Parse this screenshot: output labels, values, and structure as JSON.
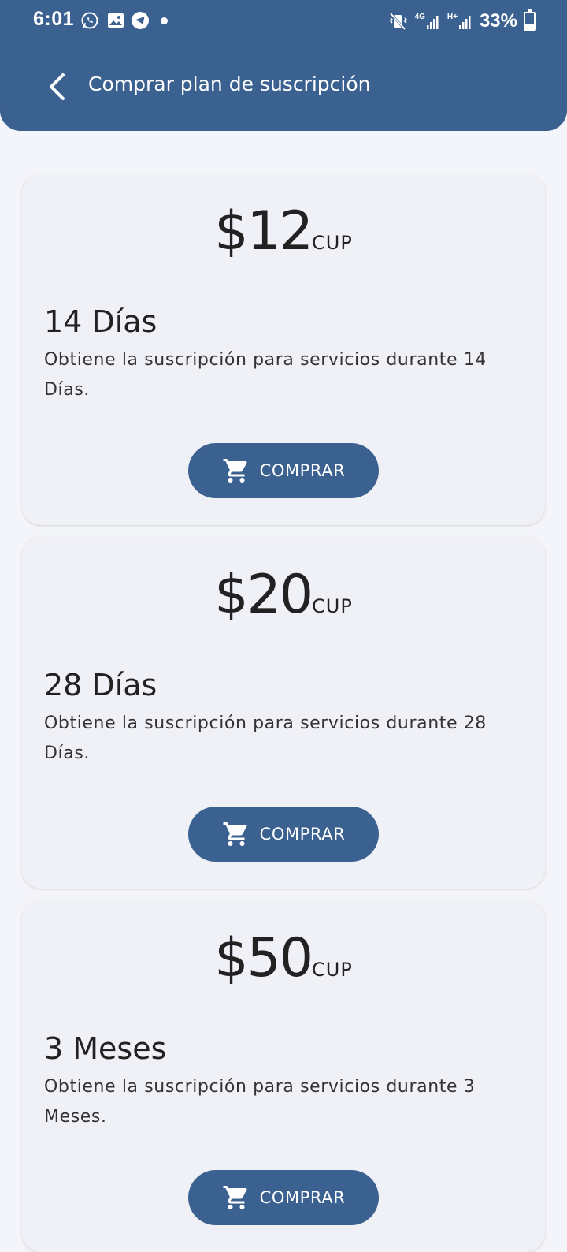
{
  "status_bar": {
    "time": "6:01",
    "network_1": "4G",
    "network_2": "H+",
    "battery": "33%",
    "battery_level": 0.33,
    "icons": [
      "whatsapp-icon",
      "gallery-icon",
      "telegram-icon",
      "notification-dot-icon",
      "mute-vibrate-icon",
      "signal-icon",
      "signal-icon",
      "battery-icon"
    ]
  },
  "header": {
    "title": "Comprar plan de suscripción",
    "back_icon": "chevron-left-icon"
  },
  "plans": [
    {
      "price": "$12",
      "currency": "CUP",
      "title": "14 Días",
      "description": "Obtiene la suscripción para servicios durante 14 Días.",
      "button_label": "COMPRAR"
    },
    {
      "price": "$20",
      "currency": "CUP",
      "title": "28 Días",
      "description": "Obtiene la suscripción para servicios durante 28 Días.",
      "button_label": "COMPRAR"
    },
    {
      "price": "$50",
      "currency": "CUP",
      "title": "3 Meses",
      "description": "Obtiene la suscripción para servicios durante 3 Meses.",
      "button_label": "COMPRAR"
    }
  ],
  "colors": {
    "primary": "#3b6191",
    "background": "#f4f5fa",
    "card": "#f0f1f7",
    "text": "#222222"
  }
}
